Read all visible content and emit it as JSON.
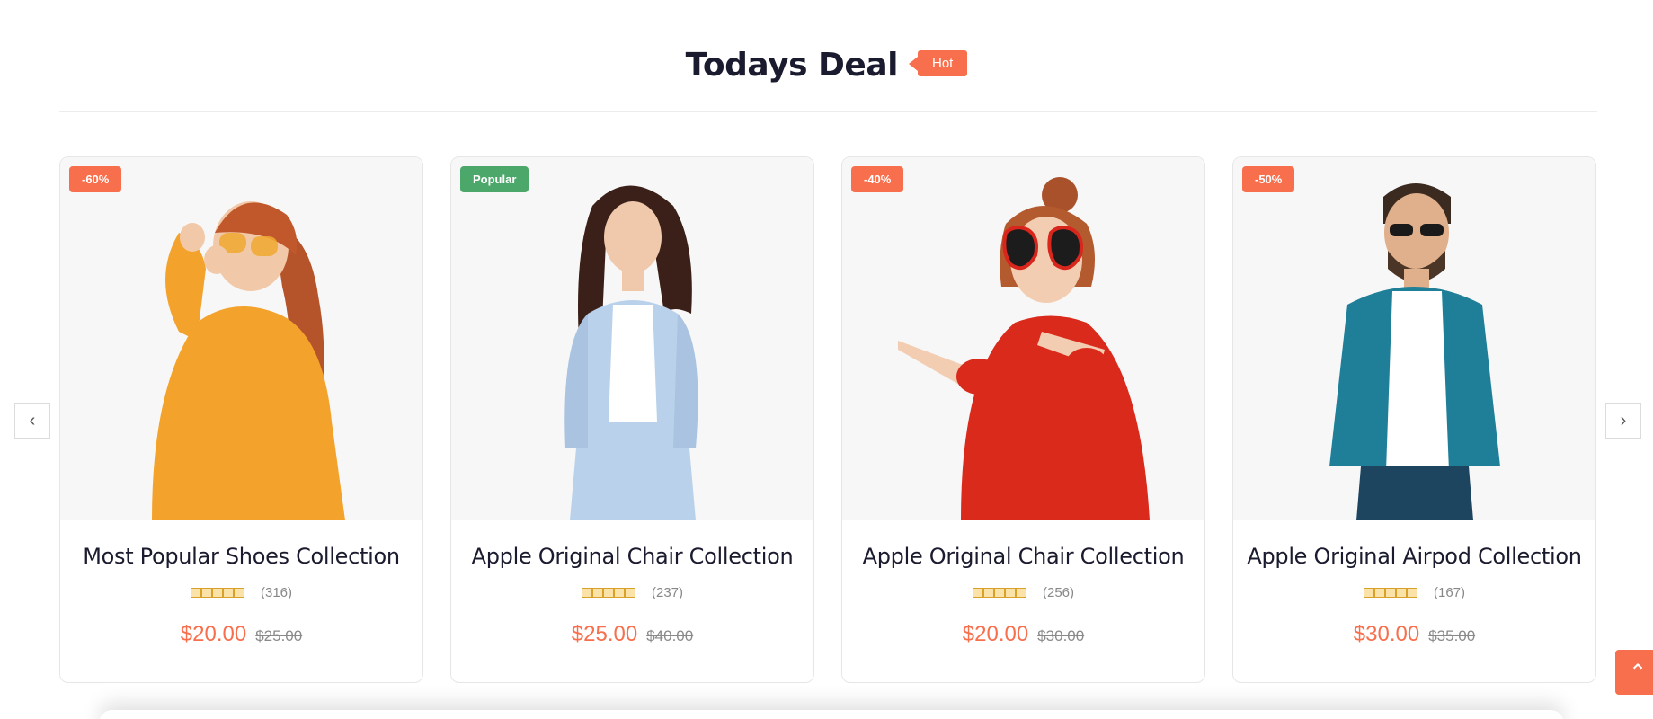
{
  "section": {
    "title": "Todays Deal",
    "badge": "Hot"
  },
  "colors": {
    "accent": "#f86f4d",
    "popular": "#4ca76a",
    "text": "#1b1b2f"
  },
  "products": [
    {
      "badge": "-60%",
      "badge_type": "sale",
      "name": "Most Popular Shoes Collection",
      "rating": 5,
      "reviews": "(316)",
      "price": "$20.00",
      "old_price": "$25.00",
      "image_icon": "woman-orange-sweater-image"
    },
    {
      "badge": "Popular",
      "badge_type": "popular",
      "name": "Apple Original Chair Collection",
      "rating": 5,
      "reviews": "(237)",
      "price": "$25.00",
      "old_price": "$40.00",
      "image_icon": "woman-blue-suit-image"
    },
    {
      "badge": "-40%",
      "badge_type": "sale",
      "name": "Apple Original Chair Collection",
      "rating": 5,
      "reviews": "(256)",
      "price": "$20.00",
      "old_price": "$30.00",
      "image_icon": "woman-red-sweater-image"
    },
    {
      "badge": "-50%",
      "badge_type": "sale",
      "name": "Apple Original Airpod Collection",
      "rating": 5,
      "reviews": "(167)",
      "price": "$30.00",
      "old_price": "$35.00",
      "image_icon": "man-denim-jacket-image"
    }
  ],
  "nav": {
    "prev_icon": "chevron-left-icon",
    "next_icon": "chevron-right-icon",
    "prev_glyph": "‹",
    "next_glyph": "›"
  },
  "scroll_top": {
    "icon": "chevron-up-icon",
    "glyph": "⌃"
  }
}
